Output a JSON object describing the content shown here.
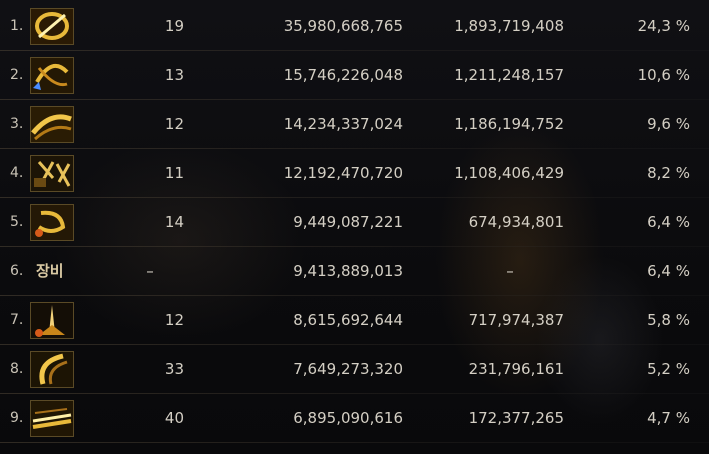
{
  "colors": {
    "text": "#d4cfc4",
    "icon_gold": "#e8b93a",
    "icon_border": "#5a4a26"
  },
  "rows": [
    {
      "rank": "1.",
      "icon": "golden-slash-circle-icon",
      "hits": "19",
      "damage": "35,980,668,765",
      "dps": "1,893,719,408",
      "percent": "24,3 %"
    },
    {
      "rank": "2.",
      "icon": "golden-spin-blade-icon",
      "hits": "13",
      "damage": "15,746,226,048",
      "dps": "1,211,248,157",
      "percent": "10,6 %"
    },
    {
      "rank": "3.",
      "icon": "golden-wave-slash-icon",
      "hits": "12",
      "damage": "14,234,337,024",
      "dps": "1,186,194,752",
      "percent": "9,6 %"
    },
    {
      "rank": "4.",
      "icon": "golden-character-sigil-icon",
      "hits": "11",
      "damage": "12,192,470,720",
      "dps": "1,108,406,429",
      "percent": "8,2 %"
    },
    {
      "rank": "5.",
      "icon": "golden-claw-icon",
      "hits": "14",
      "damage": "9,449,087,221",
      "dps": "674,934,801",
      "percent": "6,4 %"
    },
    {
      "rank": "6.",
      "icon_text": "장비",
      "hits": "–",
      "damage": "9,413,889,013",
      "dps": "–",
      "percent": "6,4 %"
    },
    {
      "rank": "7.",
      "icon": "golden-burst-icon",
      "hits": "12",
      "damage": "8,615,692,644",
      "dps": "717,974,387",
      "percent": "5,8 %"
    },
    {
      "rank": "8.",
      "icon": "golden-crescent-icon",
      "hits": "33",
      "damage": "7,649,273,320",
      "dps": "231,796,161",
      "percent": "5,2 %"
    },
    {
      "rank": "9.",
      "icon": "golden-streak-icon",
      "hits": "40",
      "damage": "6,895,090,616",
      "dps": "172,377,265",
      "percent": "4,7 %"
    }
  ]
}
